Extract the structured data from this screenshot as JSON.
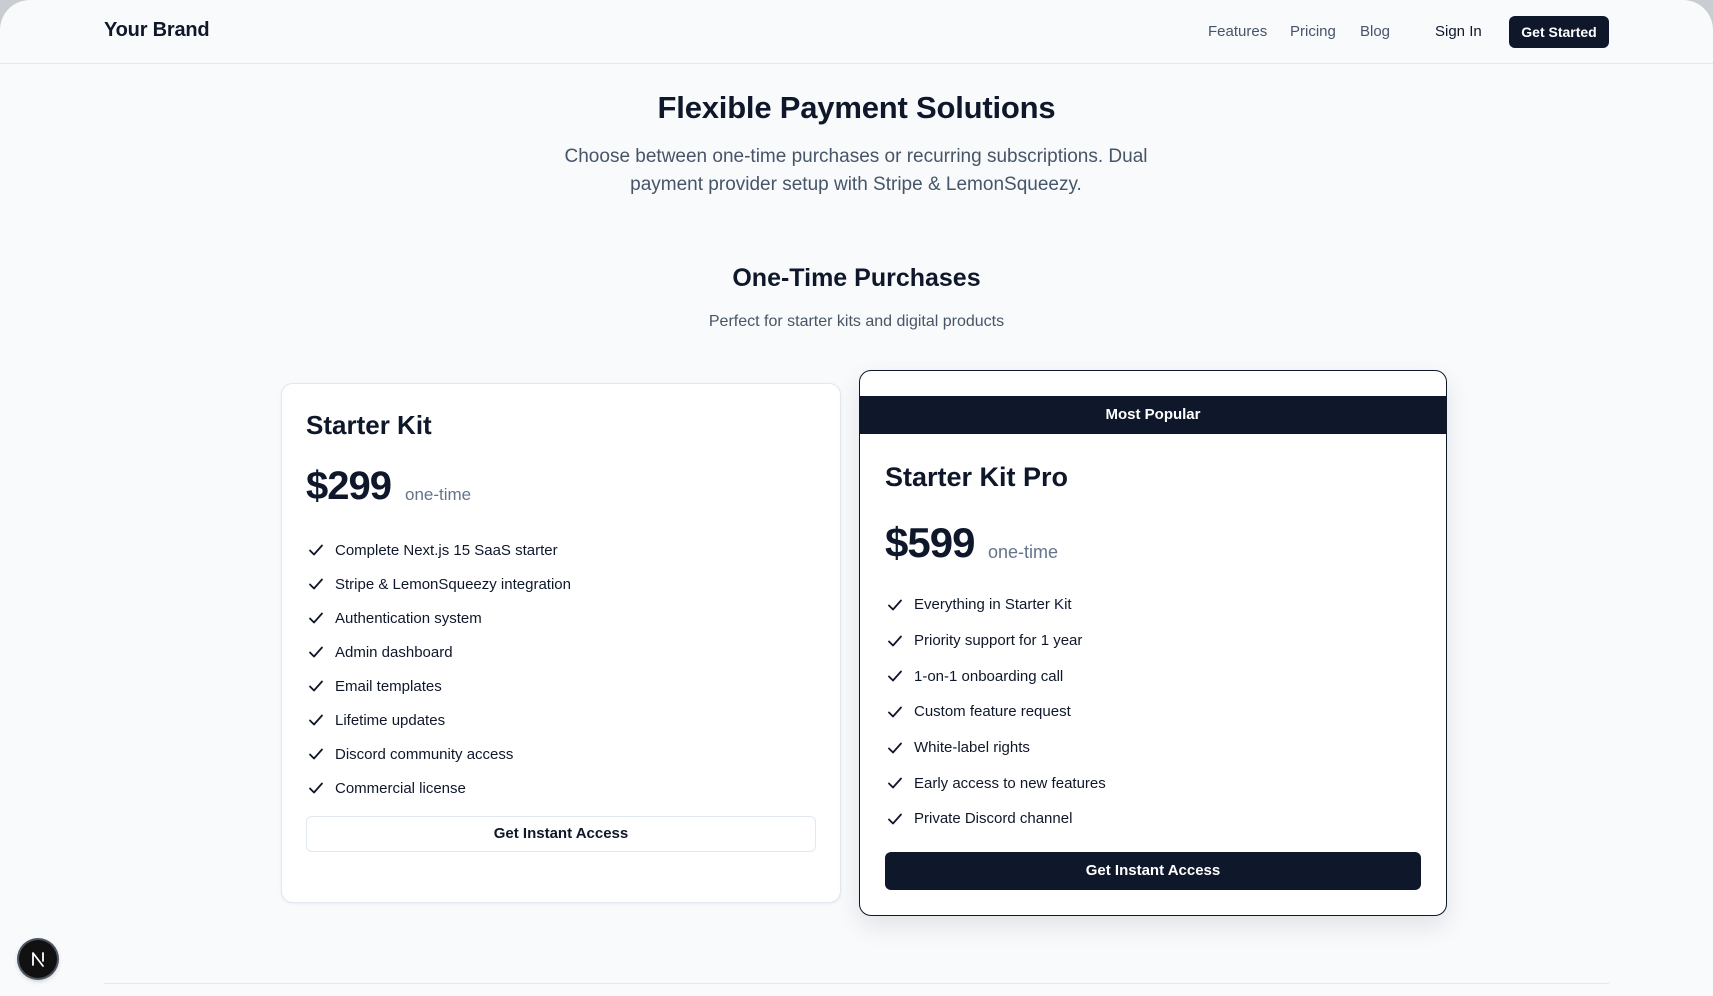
{
  "navbar": {
    "brand": "Your Brand",
    "links": [
      "Features",
      "Pricing",
      "Blog"
    ],
    "sign_in": "Sign In",
    "get_started": "Get Started"
  },
  "hero": {
    "title": "Flexible Payment Solutions",
    "subtitle": "Choose between one-time purchases or recurring subscriptions. Dual payment provider setup with Stripe & LemonSqueezy."
  },
  "section": {
    "title": "One-Time Purchases",
    "subtitle": "Perfect for starter kits and digital products"
  },
  "plans": [
    {
      "name": "Starter Kit",
      "price": "$299",
      "price_note": "one-time",
      "features": [
        "Complete Next.js 15 SaaS starter",
        "Stripe & LemonSqueezy integration",
        "Authentication system",
        "Admin dashboard",
        "Email templates",
        "Lifetime updates",
        "Discord community access",
        "Commercial license"
      ],
      "cta": "Get Instant Access"
    },
    {
      "badge": "Most Popular",
      "name": "Starter Kit Pro",
      "price": "$599",
      "price_note": "one-time",
      "features": [
        "Everything in Starter Kit",
        "Priority support for 1 year",
        "1-on-1 onboarding call",
        "Custom feature request",
        "White-label rights",
        "Early access to new features",
        "Private Discord channel"
      ],
      "cta": "Get Instant Access"
    }
  ],
  "dev_badge": {
    "icon": "nextjs-logo-icon",
    "letter": "N"
  },
  "colors": {
    "primary": "#0f172a",
    "muted_text": "#475569",
    "border": "#e2e8f0",
    "background": "#f8fafc"
  }
}
